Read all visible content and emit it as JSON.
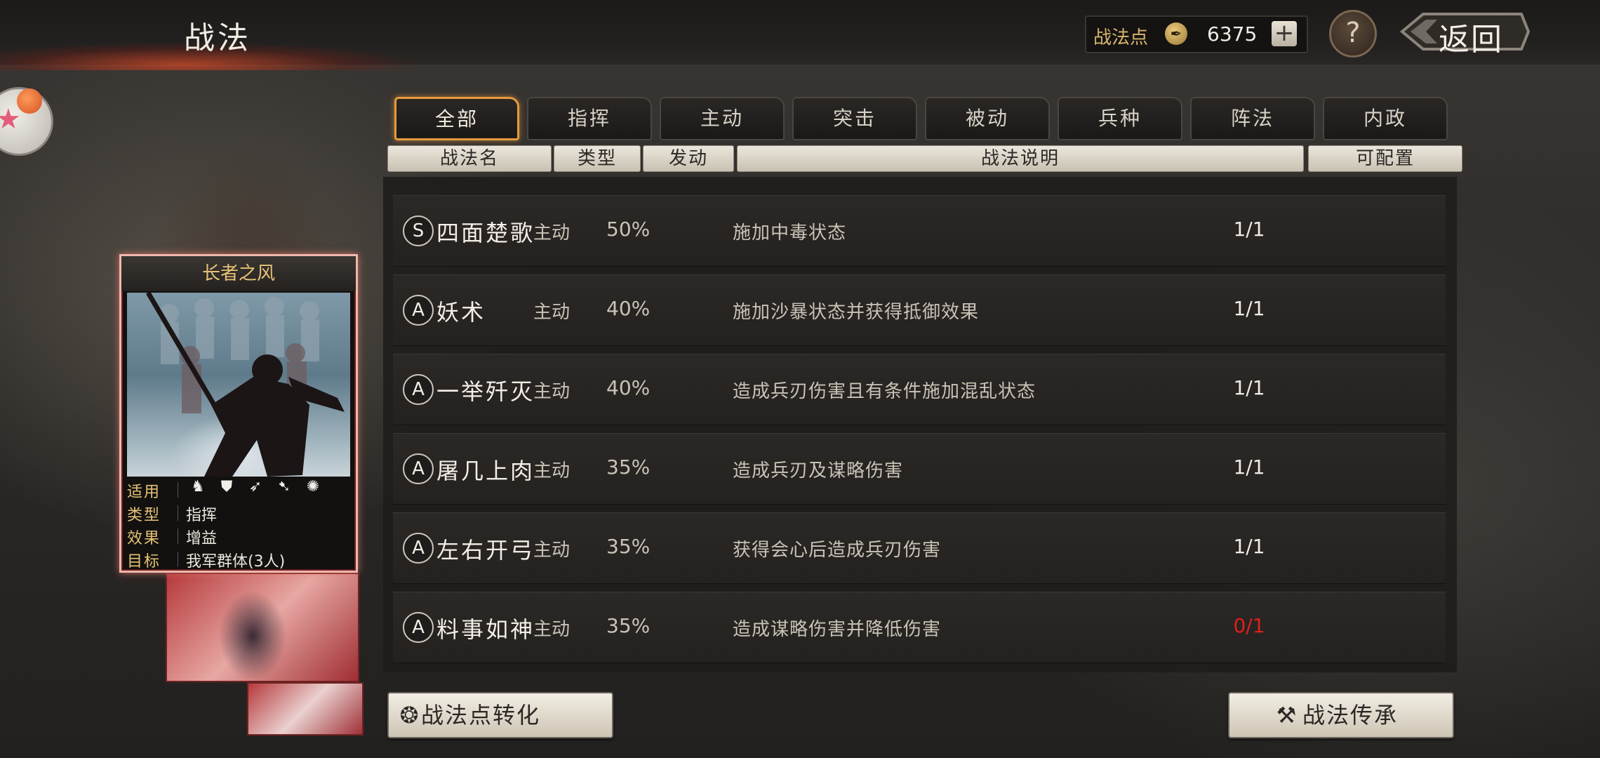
{
  "header": {
    "title": "战法",
    "points_label": "战法点",
    "points_value": "6375",
    "add_symbol": "+",
    "help_symbol": "?",
    "back_label": "返回"
  },
  "card": {
    "title": "长者之风",
    "stats": [
      {
        "key": "适用",
        "value": ""
      },
      {
        "key": "类型",
        "value": "指挥"
      },
      {
        "key": "效果",
        "value": "增益"
      },
      {
        "key": "目标",
        "value": "我军群体(3人)"
      }
    ],
    "weapon_icons": [
      "cavalry-icon",
      "shield-icon",
      "bow-icon",
      "spear-icon",
      "wheel-icon"
    ]
  },
  "tabs": [
    {
      "label": "全部",
      "active": true
    },
    {
      "label": "指挥",
      "active": false
    },
    {
      "label": "主动",
      "active": false
    },
    {
      "label": "突击",
      "active": false
    },
    {
      "label": "被动",
      "active": false
    },
    {
      "label": "兵种",
      "active": false
    },
    {
      "label": "阵法",
      "active": false
    },
    {
      "label": "内政",
      "active": false
    }
  ],
  "columns": [
    "战法名",
    "类型",
    "发动",
    "战法说明",
    "可配置"
  ],
  "skills": [
    {
      "grade": "S",
      "name": "四面楚歌",
      "type": "主动",
      "rate": "50%",
      "desc": "施加中毒状态",
      "quota": "1/1"
    },
    {
      "grade": "A",
      "name": "妖术",
      "type": "主动",
      "rate": "40%",
      "desc": "施加沙暴状态并获得抵御效果",
      "quota": "1/1"
    },
    {
      "grade": "A",
      "name": "一举歼灭",
      "type": "主动",
      "rate": "40%",
      "desc": "造成兵刃伤害且有条件施加混乱状态",
      "quota": "1/1"
    },
    {
      "grade": "A",
      "name": "屠几上肉",
      "type": "主动",
      "rate": "35%",
      "desc": "造成兵刃及谋略伤害",
      "quota": "1/1"
    },
    {
      "grade": "A",
      "name": "左右开弓",
      "type": "主动",
      "rate": "35%",
      "desc": "获得会心后造成兵刃伤害",
      "quota": "1/1"
    },
    {
      "grade": "A",
      "name": "料事如神",
      "type": "主动",
      "rate": "35%",
      "desc": "造成谋略伤害并降低伤害",
      "quota": "0/1"
    }
  ],
  "buttons": {
    "convert": "战法点转化",
    "inherit": "战法传承"
  },
  "colors": {
    "accent": "#e49a3e",
    "gold_text": "#e7c276",
    "quota_unavailable": "#e0201a"
  }
}
